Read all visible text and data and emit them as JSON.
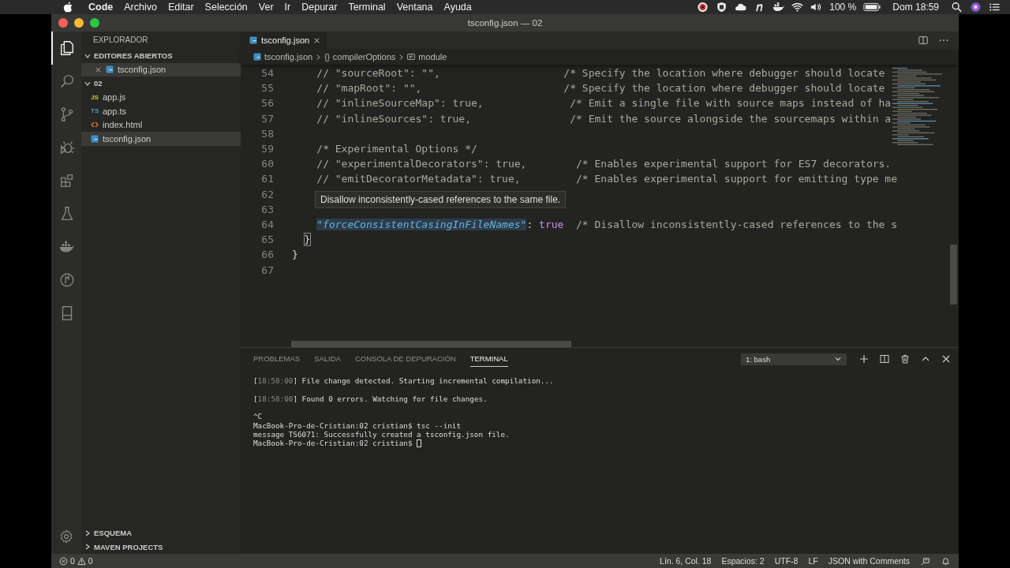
{
  "menu_bar": {
    "app": "Code",
    "items": [
      "Archivo",
      "Editar",
      "Selección",
      "Ver",
      "Ir",
      "Depurar",
      "Terminal",
      "Ventana",
      "Ayuda"
    ],
    "battery": "100 %",
    "clock": "Dom 18:59"
  },
  "window": {
    "title": "tsconfig.json — 02"
  },
  "activity_bar": [
    {
      "kind": "files",
      "selected": true
    },
    {
      "kind": "search",
      "selected": false
    },
    {
      "kind": "branch",
      "selected": false
    },
    {
      "kind": "debug",
      "selected": false
    },
    {
      "kind": "extensions",
      "selected": false
    },
    {
      "kind": "flask",
      "selected": false
    },
    {
      "kind": "whale",
      "selected": false
    },
    {
      "kind": "circle",
      "selected": false
    },
    {
      "kind": "device",
      "selected": false
    }
  ],
  "sidebar": {
    "title": "EXPLORADOR",
    "sections": [
      {
        "title": "EDITORES ABIERTOS",
        "expanded": true,
        "items": [
          {
            "name": "tsconfig.json",
            "kind": "tsconfig",
            "closable": true,
            "selected": true
          }
        ]
      },
      {
        "title": "02",
        "expanded": true,
        "items": [
          {
            "name": "app.js",
            "kind": "js",
            "badge": "JS",
            "closable": false,
            "selected": false
          },
          {
            "name": "app.ts",
            "kind": "ts",
            "badge": "TS",
            "closable": false,
            "selected": false
          },
          {
            "name": "index.html",
            "kind": "html",
            "closable": false,
            "selected": false
          },
          {
            "name": "tsconfig.json",
            "kind": "tsconfig",
            "closable": false,
            "selected": true
          }
        ]
      }
    ],
    "bottom_sections": [
      {
        "title": "ESQUEMA",
        "expanded": false
      },
      {
        "title": "MAVEN PROJECTS",
        "expanded": false
      }
    ]
  },
  "tabs": [
    {
      "label": "tsconfig.json",
      "selected": true
    }
  ],
  "breadcrumbs": [
    {
      "kind": "file",
      "text": "tsconfig.json"
    },
    {
      "kind": "object",
      "icon_text": "{}",
      "text": "compilerOptions"
    },
    {
      "kind": "property",
      "text": "module"
    }
  ],
  "code_lines": [
    {
      "number": "54",
      "segments": [
        {
          "kind": "comment",
          "text": "    // \"sourceRoot\": \"\",                    /* Specify the location where debugger should locate"
        }
      ]
    },
    {
      "number": "55",
      "segments": [
        {
          "kind": "comment",
          "text": "    // \"mapRoot\": \"\",                       /* Specify the location where debugger should locate"
        }
      ]
    },
    {
      "number": "56",
      "segments": [
        {
          "kind": "comment",
          "text": "    // \"inlineSourceMap\": true,              /* Emit a single file with source maps instead of ha"
        }
      ]
    },
    {
      "number": "57",
      "segments": [
        {
          "kind": "comment",
          "text": "    // \"inlineSources\": true,                /* Emit the source alongside the sourcemaps within a"
        }
      ]
    },
    {
      "number": "58"
    },
    {
      "number": "59",
      "segments": [
        {
          "kind": "comment",
          "text": "    /* Experimental Options */"
        }
      ]
    },
    {
      "number": "60",
      "segments": [
        {
          "kind": "comment",
          "text": "    // \"experimentalDecorators\": true,        /* Enables experimental support for ES7 decorators."
        }
      ]
    },
    {
      "number": "61",
      "segments": [
        {
          "kind": "comment",
          "text": "    // \"emitDecoratorMetadata\": true,         /* Enables experimental support for emitting type me"
        }
      ]
    },
    {
      "number": "62"
    },
    {
      "number": "63"
    },
    {
      "number": "64",
      "kind": "property",
      "segments": [
        {
          "kind": "key-selected",
          "text": "\"forceConsistentCasingInFileNames\""
        },
        {
          "kind": "plain",
          "text": ": "
        },
        {
          "kind": "bool",
          "text": "true"
        },
        {
          "kind": "comment",
          "text": "  /* Disallow inconsistently-cased references to the s"
        }
      ]
    },
    {
      "number": "65",
      "kind": "inner-close",
      "segments": [
        {
          "kind": "bracket-match",
          "text": "}"
        }
      ]
    },
    {
      "number": "66",
      "kind": "outer-close",
      "segments": [
        {
          "kind": "plain",
          "text": "}"
        }
      ]
    },
    {
      "number": "67"
    }
  ],
  "hover_tooltip": "Disallow inconsistently-cased references to the same file.",
  "panel": {
    "tabs": [
      {
        "label": "PROBLEMAS",
        "selected": false
      },
      {
        "label": "SALIDA",
        "selected": false
      },
      {
        "label": "CONSOLA DE DEPURACIÓN",
        "selected": false
      },
      {
        "label": "TERMINAL",
        "selected": true
      }
    ],
    "terminal_select": "1: bash",
    "terminal_blocks": [
      {
        "lines": [
          {
            "segments": [
              {
                "kind": "plain",
                "text": "["
              },
              {
                "kind": "dim",
                "text": "18:58:00"
              },
              {
                "kind": "plain",
                "text": "] File change detected. Starting incremental compilation..."
              }
            ]
          }
        ]
      },
      {
        "lines": [
          {
            "segments": [
              {
                "kind": "plain",
                "text": "["
              },
              {
                "kind": "dim",
                "text": "18:58:00"
              },
              {
                "kind": "plain",
                "text": "] Found 0 errors. Watching for file changes."
              }
            ]
          }
        ]
      },
      {
        "lines": [
          {
            "segments": [
              {
                "kind": "plain",
                "text": "^C"
              }
            ]
          },
          {
            "segments": [
              {
                "kind": "plain",
                "text": "MacBook-Pro-de-Cristian:02 cristian$ tsc --init"
              }
            ]
          },
          {
            "segments": [
              {
                "kind": "plain",
                "text": "message TS6071: Successfully created a tsconfig.json file."
              }
            ]
          },
          {
            "cursor": true,
            "segments": [
              {
                "kind": "plain",
                "text": "MacBook-Pro-de-Cristian:02 cristian$ "
              }
            ]
          }
        ]
      }
    ]
  },
  "status_bar": {
    "errors": "0",
    "warnings": "0",
    "items": [
      "Lín. 6, Col. 18",
      "Espacios: 2",
      "UTF-8",
      "LF",
      "JSON with Comments"
    ]
  }
}
